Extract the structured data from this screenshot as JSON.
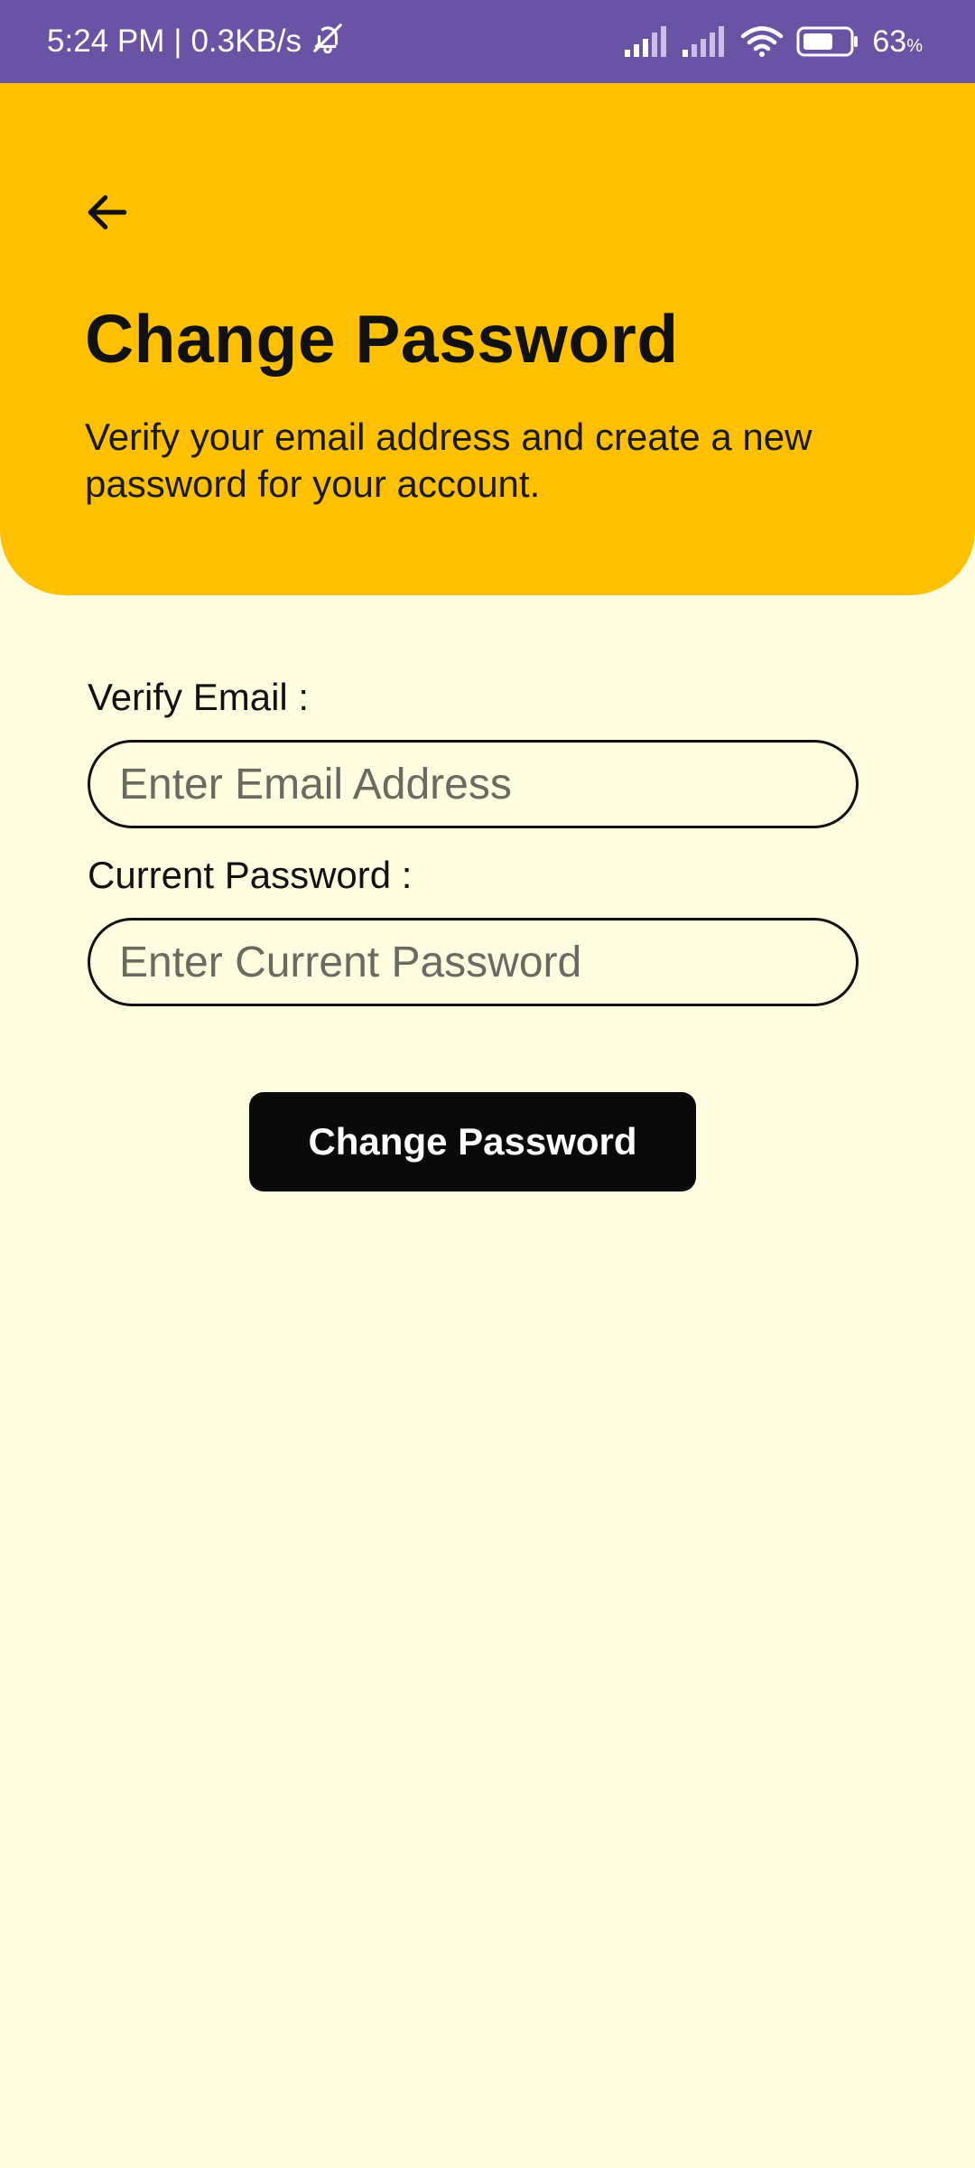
{
  "status_bar": {
    "time": "5:24 PM",
    "separator": "|",
    "network_speed": "0.3KB/s",
    "battery_percent": "63",
    "battery_unit": "%",
    "icons": [
      "bell-muted-icon",
      "signal-icon",
      "signal-icon",
      "wifi-icon",
      "battery-icon"
    ]
  },
  "header": {
    "back_icon": "arrow-left-icon",
    "title": "Change Password",
    "subtitle": "Verify your email address and create a new password for your account."
  },
  "form": {
    "email_label": "Verify Email :",
    "email_placeholder": "Enter Email Address",
    "email_value": "",
    "password_label": "Current Password :",
    "password_placeholder": "Enter Current Password",
    "password_value": ""
  },
  "actions": {
    "submit_label": "Change Password"
  },
  "colors": {
    "status_bar": "#6A52A5",
    "header": "#FFC000",
    "background": "#FFFDE0",
    "button": "#0A0A0A"
  }
}
